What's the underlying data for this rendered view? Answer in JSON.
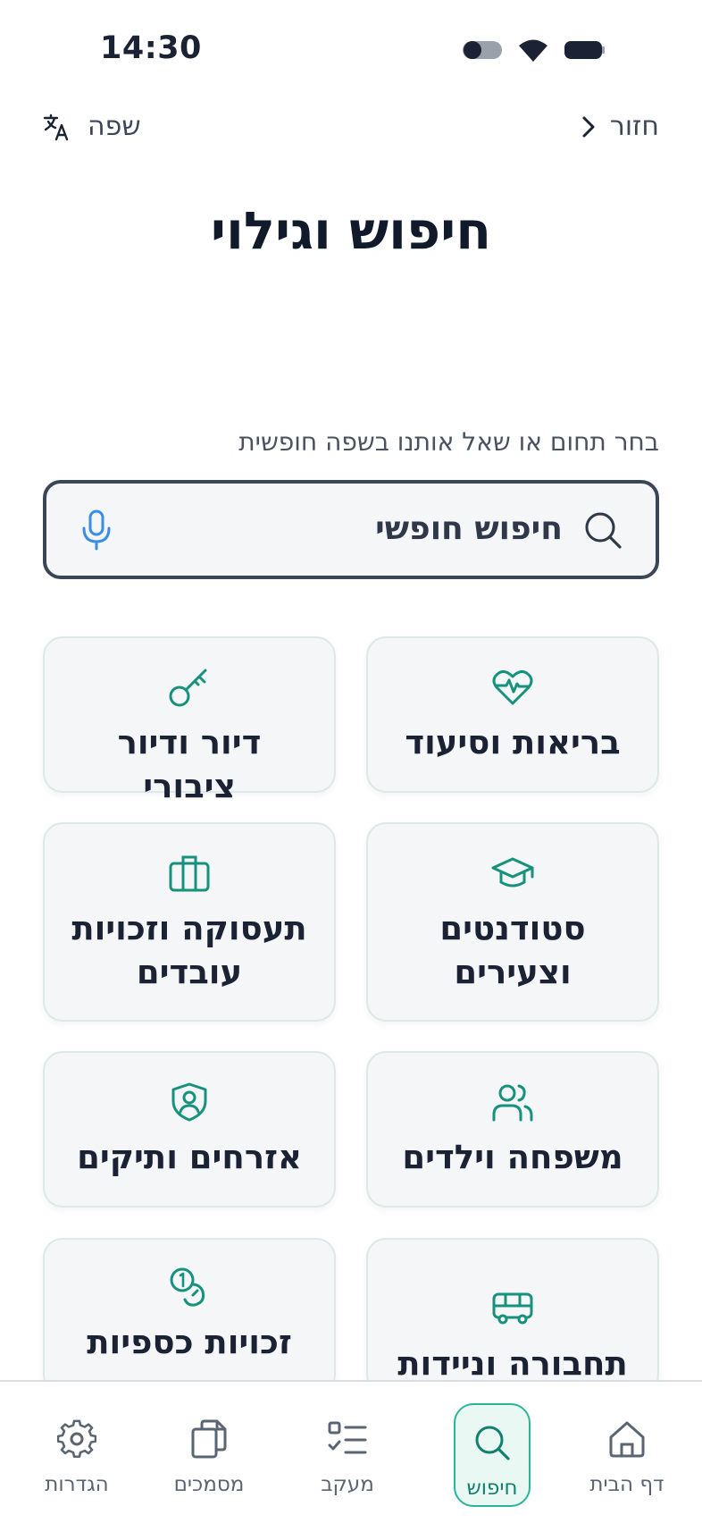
{
  "status_bar": {
    "time": "14:30"
  },
  "top_nav": {
    "back_label": "חזור",
    "language_label": "שפה"
  },
  "page": {
    "title": "חיפוש וגילוי",
    "hint": "בחר תחום או שאל אותנו בשפה חופשית"
  },
  "search": {
    "label": "חיפוש חופשי"
  },
  "categories": [
    {
      "label": "בריאות וסיעוד",
      "icon": "heart-pulse-icon"
    },
    {
      "label": "דיור ודיור ציבורי",
      "icon": "key-icon"
    },
    {
      "label": "סטודנטים וצעירים",
      "icon": "graduation-cap-icon"
    },
    {
      "label": "תעסוקה וזכויות עובדים",
      "icon": "briefcase-icon"
    },
    {
      "label": "משפחה וילדים",
      "icon": "users-icon"
    },
    {
      "label": "אזרחים ותיקים",
      "icon": "shield-user-icon"
    },
    {
      "label": "תחבורה וניידות",
      "icon": "bus-icon"
    },
    {
      "label": "זכויות כספיות",
      "icon": "coins-icon"
    }
  ],
  "bottom_nav": [
    {
      "label": "דף הבית",
      "icon": "home-icon"
    },
    {
      "label": "חיפוש",
      "icon": "search-icon",
      "active": true
    },
    {
      "label": "מעקב",
      "icon": "checklist-icon"
    },
    {
      "label": "מסמכים",
      "icon": "documents-icon"
    },
    {
      "label": "הגדרות",
      "icon": "gear-icon"
    }
  ],
  "colors": {
    "accent": "#11806d",
    "accent_light": "#eaf8f4",
    "text": "#1a2233",
    "card_bg": "#f4f6f8"
  }
}
